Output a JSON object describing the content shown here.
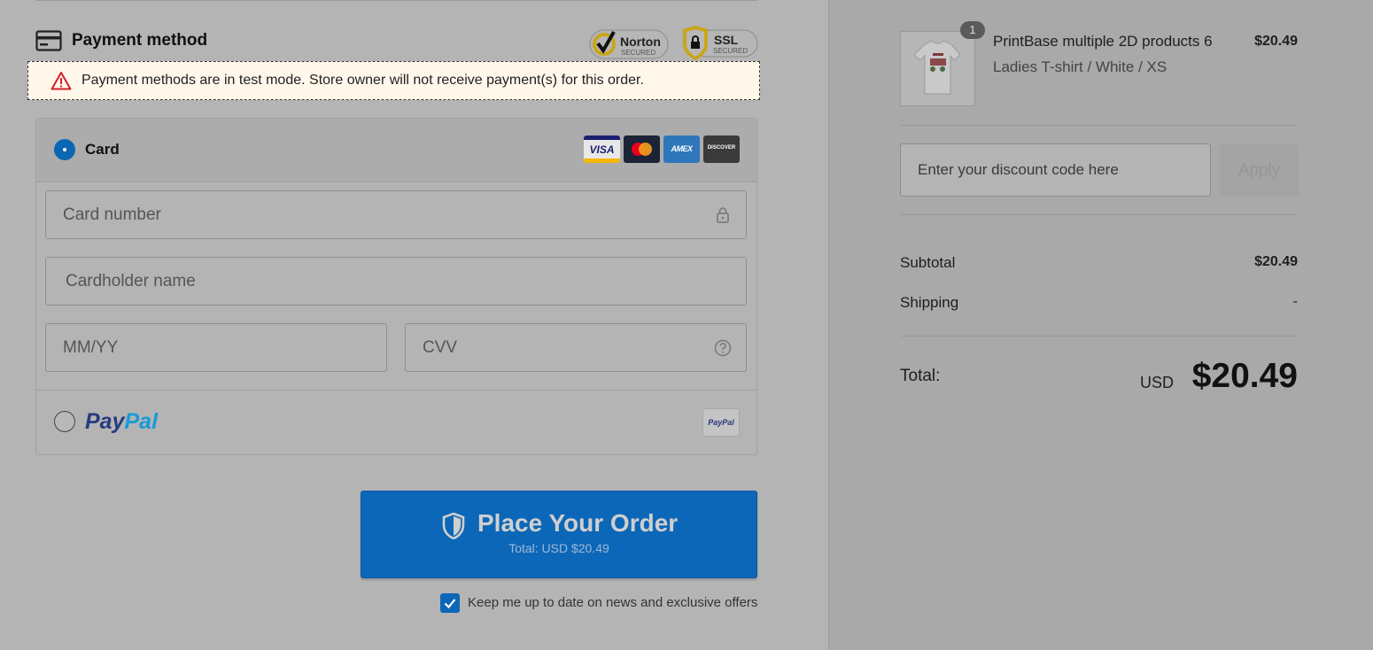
{
  "payment": {
    "title": "Payment method",
    "badges": {
      "norton_main": "Norton",
      "norton_sub": "SECURED",
      "ssl_main": "SSL",
      "ssl_sub": "SECURED"
    },
    "alert": "Payment methods are in test mode. Store owner will not receive payment(s) for this order.",
    "card": {
      "label": "Card",
      "selected": true,
      "brands": {
        "visa": "VISA",
        "amex": "AMEX",
        "discover": "DISCOVER"
      },
      "fields": {
        "card_number": "Card number",
        "cardholder": "Cardholder name",
        "expiry": "MM/YY",
        "cvv": "CVV"
      }
    },
    "paypal": {
      "logo_a": "Pay",
      "logo_b": "Pal",
      "small": "PayPal",
      "selected": false
    }
  },
  "order_button": {
    "label": "Place Your Order",
    "sub": "Total: USD $20.49"
  },
  "newsletter": {
    "label": "Keep me up to date on news and exclusive offers",
    "checked": true
  },
  "summary": {
    "item": {
      "qty": "1",
      "name": "PrintBase multiple 2D products 6",
      "variant": "Ladies T-shirt / White / XS",
      "price": "$20.49"
    },
    "discount": {
      "placeholder": "Enter your discount code here",
      "apply": "Apply"
    },
    "subtotal_label": "Subtotal",
    "subtotal": "$20.49",
    "shipping_label": "Shipping",
    "shipping": "-",
    "total_label": "Total:",
    "currency": "USD",
    "total": "$20.49"
  },
  "colors": {
    "accent": "#0c67b8",
    "alert_bg": "#fff7ea",
    "warning": "#d0202a"
  }
}
